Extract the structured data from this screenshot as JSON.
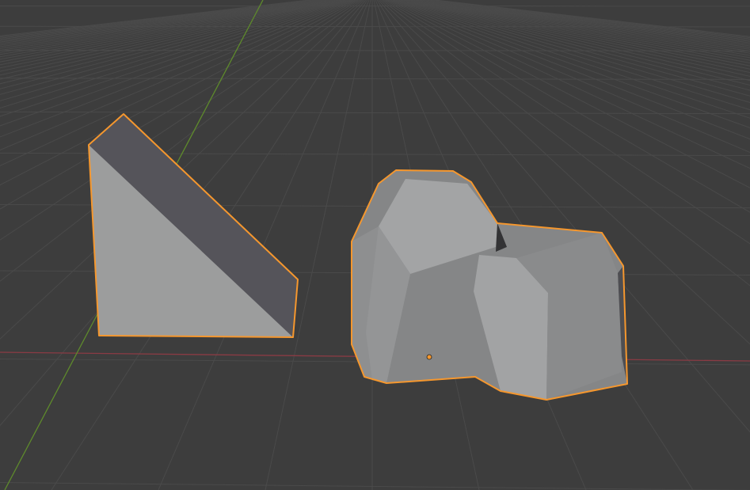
{
  "viewport": {
    "background": "#3d3d3d",
    "grid_color": "#4a4a4a",
    "x_axis_color": "#8a3b44",
    "y_axis_color": "#5e8a2c",
    "selection_outline": "#f5972e",
    "origin_color": "#f5972e"
  },
  "objects": [
    {
      "name": "wedge",
      "selected": true
    },
    {
      "name": "rock",
      "selected": true,
      "active": true
    }
  ]
}
